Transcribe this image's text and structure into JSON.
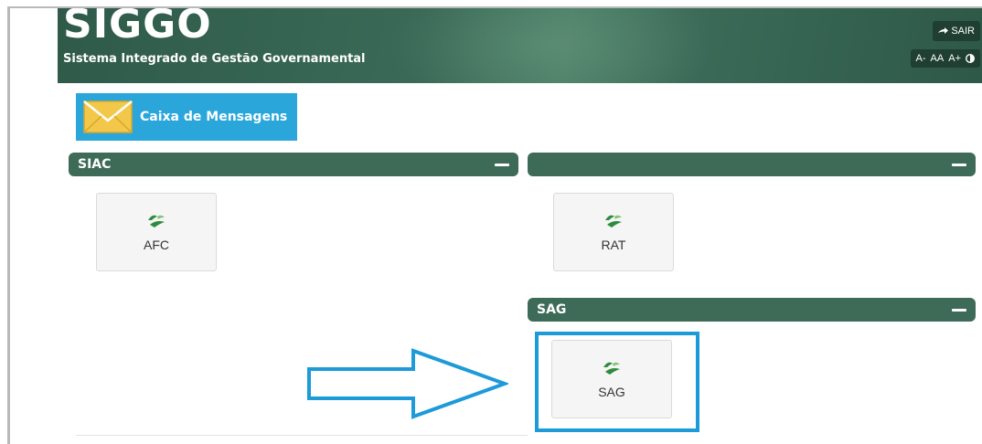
{
  "header": {
    "brand": "SIGGO",
    "subtitle": "Sistema Integrado de Gestão Governamental",
    "logout_label": "SAIR",
    "font_controls": [
      "A-",
      "AA",
      "A+"
    ],
    "contrast_icon": "half-circle-icon"
  },
  "messages": {
    "label": "Caixa de Mensagens",
    "icon": "envelope-icon"
  },
  "sections": [
    {
      "title": "SIAC",
      "tiles": [
        {
          "label": "AFC"
        }
      ]
    },
    {
      "title": "",
      "tiles": [
        {
          "label": "RAT"
        }
      ]
    },
    {
      "title": "SAG",
      "tiles": [
        {
          "label": "SAG"
        }
      ]
    }
  ],
  "colors": {
    "header": "#3a6a57",
    "bar": "#3e6b57",
    "message_box": "#2aa6db",
    "highlight": "#1d9ad8"
  }
}
